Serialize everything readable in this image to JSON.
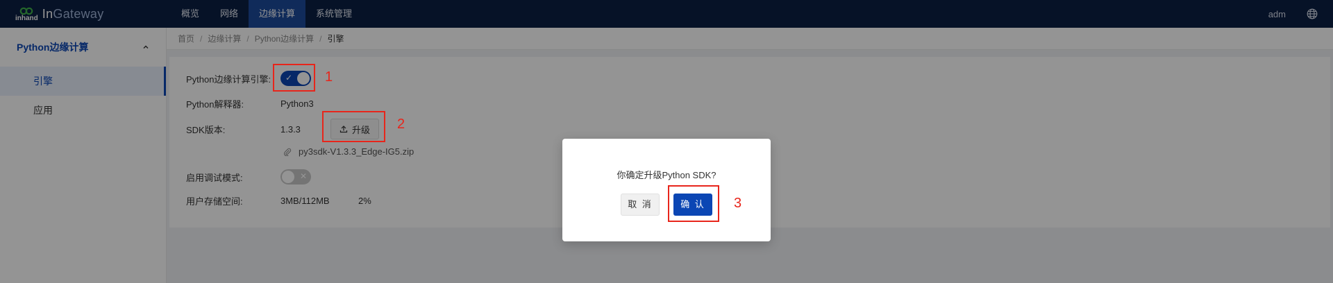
{
  "brand": {
    "prefix": "inhand",
    "name_a": "In",
    "name_b": "Gateway"
  },
  "nav": [
    {
      "label": "概览",
      "active": false
    },
    {
      "label": "网络",
      "active": false
    },
    {
      "label": "边缘计算",
      "active": true
    },
    {
      "label": "系统管理",
      "active": false
    }
  ],
  "user": "adm",
  "sidebar": {
    "group": "Python边缘计算",
    "items": [
      {
        "label": "引擎",
        "active": true
      },
      {
        "label": "应用",
        "active": false
      }
    ]
  },
  "breadcrumb": [
    "首页",
    "边缘计算",
    "Python边缘计算",
    "引擎"
  ],
  "engine": {
    "engine_label": "Python边缘计算引擎:",
    "engine_enabled": true,
    "interpreter_label": "Python解释器:",
    "interpreter_value": "Python3",
    "sdk_label": "SDK版本:",
    "sdk_value": "1.3.3",
    "upgrade_label": "升级",
    "sdk_file": "py3sdk-V1.3.3_Edge-IG5.zip",
    "debug_label": "启用调试模式:",
    "debug_enabled": false,
    "storage_label": "用户存储空间:",
    "storage_value": "3MB/112MB",
    "storage_percent": "2%"
  },
  "dialog": {
    "message": "你确定升级Python SDK?",
    "cancel_label": "取 消",
    "confirm_label": "确 认"
  },
  "annotations": [
    "1",
    "2",
    "3"
  ],
  "colors": {
    "primary": "#0b46b4",
    "topbar": "#0c1f44",
    "annotation": "#e8251b"
  }
}
